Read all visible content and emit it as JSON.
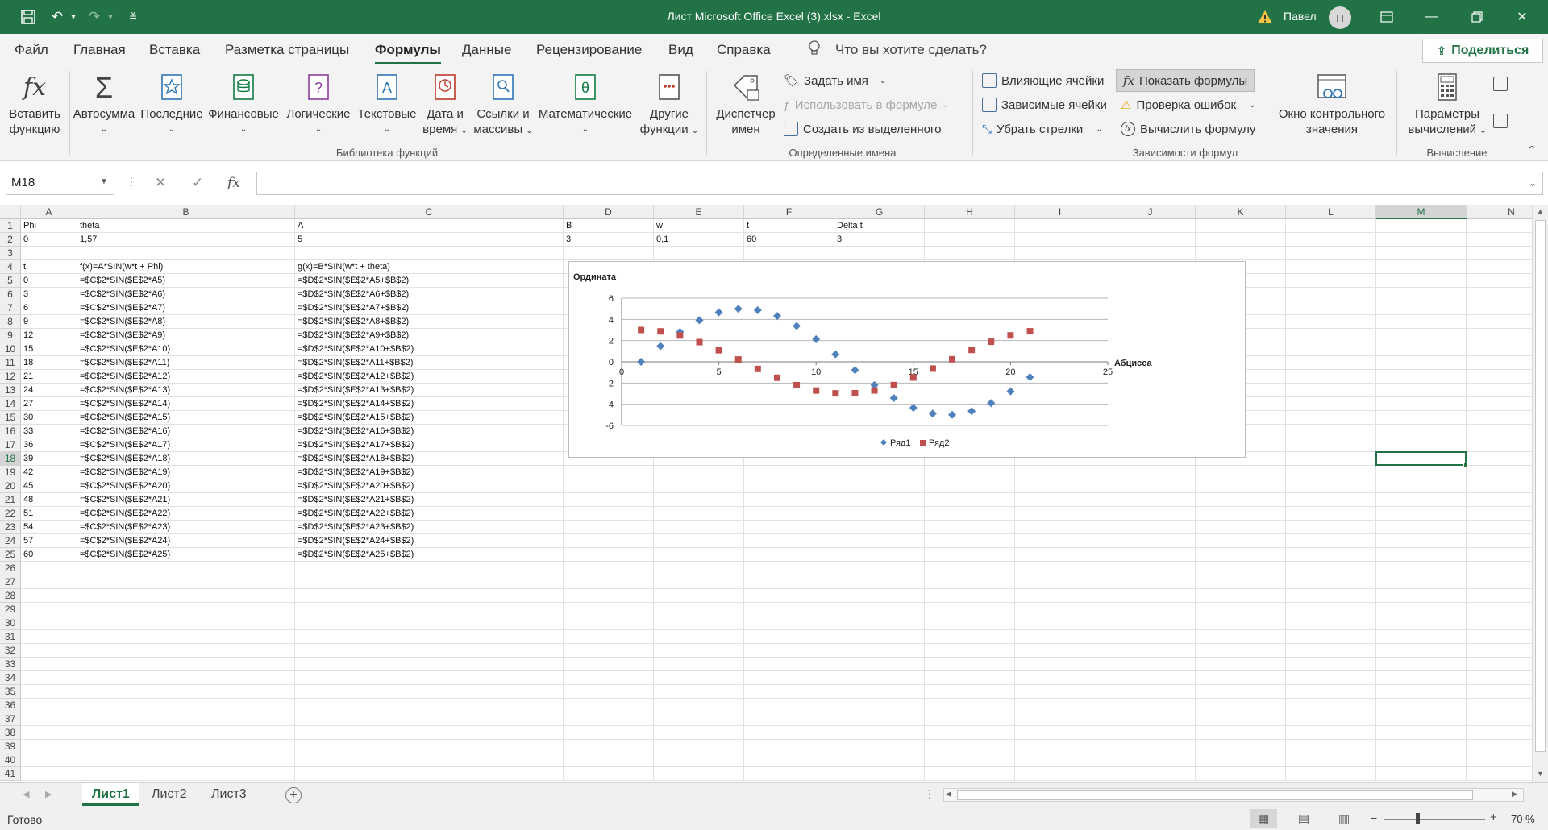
{
  "window": {
    "title": "Лист Microsoft Office Excel (3).xlsx  -  Excel",
    "user": "Павел",
    "avatar_initial": "П"
  },
  "menu": {
    "tabs": [
      "Файл",
      "Главная",
      "Вставка",
      "Разметка страницы",
      "Формулы",
      "Данные",
      "Рецензирование",
      "Вид",
      "Справка"
    ],
    "active": "Формулы",
    "search_placeholder": "Что вы хотите сделать?",
    "share_label": "Поделиться"
  },
  "ribbon": {
    "insert_function": [
      "Вставить",
      "функцию"
    ],
    "library": {
      "autosum": "Автосумма",
      "recent": "Последние",
      "financial": "Финансовые",
      "logical": "Логические",
      "text": "Текстовые",
      "datetime": [
        "Дата и",
        "время"
      ],
      "lookup": [
        "Ссылки и",
        "массивы"
      ],
      "math": "Математические",
      "other": [
        "Другие",
        "функции"
      ],
      "group_label": "Библиотека функций"
    },
    "names": {
      "manager": [
        "Диспетчер",
        "имен"
      ],
      "define": "Задать имя",
      "use_in_formula": "Использовать в формуле",
      "create_from_selection": "Создать из выделенного",
      "group_label": "Определенные имена"
    },
    "audit": {
      "trace_precedents": "Влияющие ячейки",
      "trace_dependents": "Зависимые ячейки",
      "remove_arrows": "Убрать стрелки",
      "show_formulas": "Показать формулы",
      "error_checking": "Проверка ошибок",
      "evaluate": "Вычислить формулу",
      "watch_window": [
        "Окно контрольного",
        "значения"
      ],
      "group_label": "Зависимости формул"
    },
    "calc": {
      "options": [
        "Параметры",
        "вычислений"
      ],
      "group_label": "Вычисление"
    }
  },
  "formula_bar": {
    "name_box": "M18",
    "content": ""
  },
  "columns": [
    "A",
    "B",
    "C",
    "D",
    "E",
    "F",
    "G",
    "H",
    "I",
    "J",
    "K",
    "L",
    "M",
    "N"
  ],
  "selected_column": "M",
  "selected_row": 18,
  "rows_visible": 41,
  "cells": {
    "row1": {
      "A": "Phi",
      "B": "theta",
      "C": "A",
      "D": "B",
      "E": "w",
      "F": "t",
      "G": "Delta t"
    },
    "row2": {
      "A": "0",
      "B": "1,57",
      "C": "5",
      "D": "3",
      "E": "0,1",
      "F": "60",
      "G": "3"
    },
    "row4": {
      "A": "t",
      "B": "f(x)=A*SIN(w*t + Phi)",
      "C": "g(x)=B*SIN(w*t + theta)"
    },
    "t_values": [
      "0",
      "3",
      "6",
      "9",
      "12",
      "15",
      "18",
      "21",
      "24",
      "27",
      "30",
      "33",
      "36",
      "39",
      "42",
      "45",
      "48",
      "51",
      "54",
      "57",
      "60"
    ],
    "f_formulas": [
      "=$C$2*SIN($E$2*A5)",
      "=$C$2*SIN($E$2*A6)",
      "=$C$2*SIN($E$2*A7)",
      "=$C$2*SIN($E$2*A8)",
      "=$C$2*SIN($E$2*A9)",
      "=$C$2*SIN($E$2*A10)",
      "=$C$2*SIN($E$2*A11)",
      "=$C$2*SIN($E$2*A12)",
      "=$C$2*SIN($E$2*A13)",
      "=$C$2*SIN($E$2*A14)",
      "=$C$2*SIN($E$2*A15)",
      "=$C$2*SIN($E$2*A16)",
      "=$C$2*SIN($E$2*A17)",
      "=$C$2*SIN($E$2*A18)",
      "=$C$2*SIN($E$2*A19)",
      "=$C$2*SIN($E$2*A20)",
      "=$C$2*SIN($E$2*A21)",
      "=$C$2*SIN($E$2*A22)",
      "=$C$2*SIN($E$2*A23)",
      "=$C$2*SIN($E$2*A24)",
      "=$C$2*SIN($E$2*A25)"
    ],
    "g_formulas": [
      "=$D$2*SIN($E$2*A5+$B$2)",
      "=$D$2*SIN($E$2*A6+$B$2)",
      "=$D$2*SIN($E$2*A7+$B$2)",
      "=$D$2*SIN($E$2*A8+$B$2)",
      "=$D$2*SIN($E$2*A9+$B$2)",
      "=$D$2*SIN($E$2*A10+$B$2)",
      "=$D$2*SIN($E$2*A11+$B$2)",
      "=$D$2*SIN($E$2*A12+$B$2)",
      "=$D$2*SIN($E$2*A13+$B$2)",
      "=$D$2*SIN($E$2*A14+$B$2)",
      "=$D$2*SIN($E$2*A15+$B$2)",
      "=$D$2*SIN($E$2*A16+$B$2)",
      "=$D$2*SIN($E$2*A17+$B$2)",
      "=$D$2*SIN($E$2*A18+$B$2)",
      "=$D$2*SIN($E$2*A19+$B$2)",
      "=$D$2*SIN($E$2*A20+$B$2)",
      "=$D$2*SIN($E$2*A21+$B$2)",
      "=$D$2*SIN($E$2*A22+$B$2)",
      "=$D$2*SIN($E$2*A23+$B$2)",
      "=$D$2*SIN($E$2*A24+$B$2)",
      "=$D$2*SIN($E$2*A25+$B$2)"
    ]
  },
  "chart_data": {
    "type": "scatter",
    "title": "",
    "xlabel": "Абцисса",
    "ylabel": "Ордината",
    "xlim": [
      0,
      25
    ],
    "ylim": [
      -6,
      6
    ],
    "xticks": [
      0,
      5,
      10,
      15,
      20,
      25
    ],
    "yticks": [
      -6,
      -4,
      -2,
      0,
      2,
      4,
      6
    ],
    "grid": "horizontal",
    "legend_position": "bottom",
    "series": [
      {
        "name": "Ряд1",
        "color": "#4f81bd",
        "marker": "diamond",
        "x": [
          1,
          2,
          3,
          4,
          5,
          6,
          7,
          8,
          9,
          10,
          11,
          12,
          13,
          14,
          15,
          16,
          17,
          18,
          19,
          20,
          21
        ],
        "y": [
          0,
          1.48,
          2.82,
          3.92,
          4.66,
          4.99,
          4.87,
          4.32,
          3.38,
          2.14,
          0.71,
          -0.79,
          -2.19,
          -3.42,
          -4.34,
          -4.88,
          -4.99,
          -4.65,
          -3.89,
          -2.78,
          -1.44
        ]
      },
      {
        "name": "Ряд2",
        "color": "#c0504d",
        "marker": "square",
        "x": [
          1,
          2,
          3,
          4,
          5,
          6,
          7,
          8,
          9,
          10,
          11,
          12,
          13,
          14,
          15,
          16,
          17,
          18,
          19,
          20,
          21
        ],
        "y": [
          3,
          2.87,
          2.48,
          1.86,
          1.09,
          0.22,
          -0.67,
          -1.5,
          -2.2,
          -2.71,
          -2.97,
          -2.96,
          -2.7,
          -2.19,
          -1.48,
          -0.64,
          0.24,
          1.12,
          1.89,
          2.49,
          2.88
        ]
      }
    ]
  },
  "sheets": {
    "tabs": [
      "Лист1",
      "Лист2",
      "Лист3"
    ],
    "active": "Лист1"
  },
  "status": {
    "text": "Готово",
    "zoom": "70 %",
    "zoom_percent": 70
  }
}
